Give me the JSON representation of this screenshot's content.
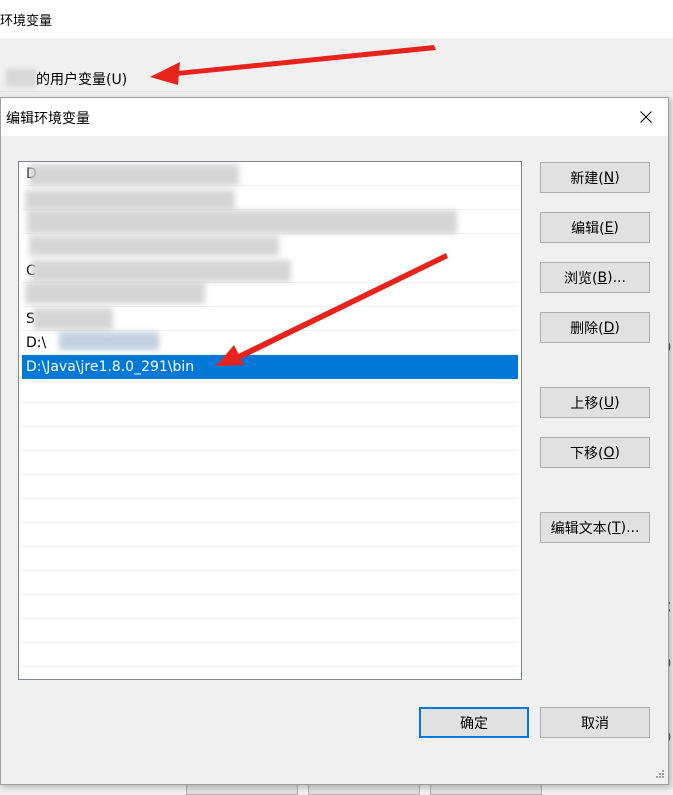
{
  "background_window": {
    "title": "环境变量",
    "user_vars_label": "的用户变量(U)"
  },
  "dialog": {
    "title": "编辑环境变量",
    "close_icon": "close-icon",
    "list": {
      "visible_rows": [
        {
          "prefix": "D",
          "obscured": true
        },
        {
          "prefix": "",
          "obscured": true
        },
        {
          "prefix": "",
          "obscured": true
        },
        {
          "prefix": "C",
          "obscured": true
        },
        {
          "prefix": "",
          "obscured": true
        },
        {
          "prefix": "S",
          "obscured": true
        },
        {
          "prefix": "D:\\",
          "obscured": true
        },
        {
          "prefix": "D:\\Java\\jre1.8.0_291\\bin",
          "obscured": false,
          "selected": true
        }
      ],
      "selected_value": "D:\\Java\\jre1.8.0_291\\bin"
    },
    "buttons": {
      "new": {
        "text": "新建(",
        "key": "N",
        "end": ")"
      },
      "edit": {
        "text": "编辑(",
        "key": "E",
        "end": ")"
      },
      "browse": {
        "text": "浏览(",
        "key": "B",
        "end": ")..."
      },
      "delete": {
        "text": "删除(",
        "key": "D",
        "end": ")"
      },
      "move_up": {
        "text": "上移(",
        "key": "U",
        "end": ")"
      },
      "move_down": {
        "text": "下移(",
        "key": "O",
        "end": ")"
      },
      "edit_text": {
        "text": "编辑文本(",
        "key": "T",
        "end": ")..."
      },
      "ok": "确定",
      "cancel": "取消"
    }
  },
  "colors": {
    "selection": "#0078d7",
    "annotation_arrow": "#e8231b"
  }
}
